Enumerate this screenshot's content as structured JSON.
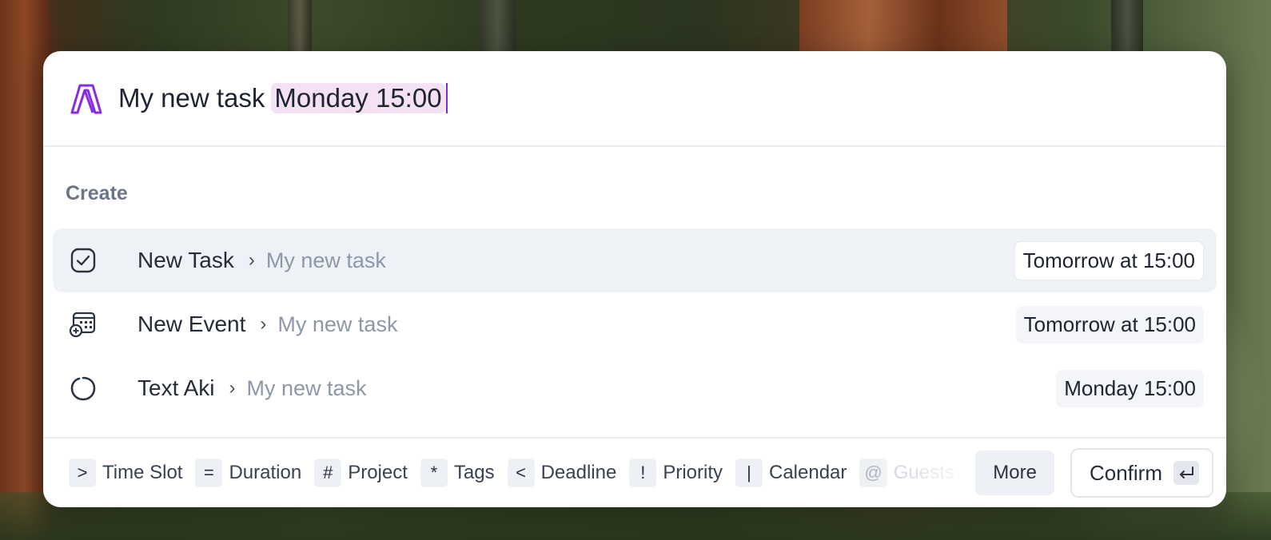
{
  "command_bar": {
    "query_plain": "My new task",
    "query_highlight": "Monday 15:00"
  },
  "section_label": "Create",
  "items": [
    {
      "title": "New Task",
      "subtitle": "My new task",
      "when": "Tomorrow at 15:00",
      "icon": "check-square-icon"
    },
    {
      "title": "New Event",
      "subtitle": "My new task",
      "when": "Tomorrow at 15:00",
      "icon": "calendar-add-icon"
    },
    {
      "title": "Text Aki",
      "subtitle": "My new task",
      "when": "Monday 15:00",
      "icon": "circle-icon"
    }
  ],
  "footer": {
    "chips": [
      {
        "key": ">",
        "label": "Time Slot"
      },
      {
        "key": "=",
        "label": "Duration"
      },
      {
        "key": "#",
        "label": "Project"
      },
      {
        "key": "*",
        "label": "Tags"
      },
      {
        "key": "<",
        "label": "Deadline"
      },
      {
        "key": "!",
        "label": "Priority"
      },
      {
        "key": "|",
        "label": "Calendar"
      },
      {
        "key": "@",
        "label": "Guests"
      }
    ],
    "more_label": "More",
    "confirm_label": "Confirm"
  },
  "colors": {
    "accent": "#7c2bd9",
    "highlight_bg": "#f4e1f6",
    "active_row_bg": "#eef1f6"
  }
}
